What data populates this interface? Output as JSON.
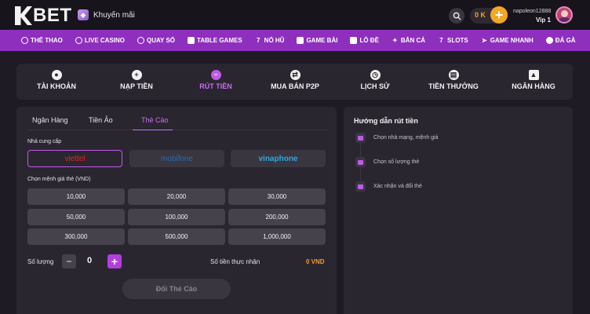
{
  "header": {
    "logo_text": "BET",
    "promo_label": "Khuyến mãi",
    "balance": "0 K",
    "deposit_symbol": "+",
    "username": "napoleon12888",
    "vip": "Vip 1"
  },
  "main_nav": [
    {
      "label": "THỂ THAO",
      "icon": "soccer-ball-icon"
    },
    {
      "label": "LIVE CASINO",
      "icon": "casino-chip-icon"
    },
    {
      "label": "QUAY SỐ",
      "icon": "lottery-ball-icon"
    },
    {
      "label": "TABLE GAMES",
      "icon": "cards-table-icon"
    },
    {
      "label": "NỔ HŨ",
      "icon": "slot-seven-icon"
    },
    {
      "label": "GAME BÀI",
      "icon": "playing-card-icon"
    },
    {
      "label": "LÔ ĐỀ",
      "icon": "lotto-icon"
    },
    {
      "label": "BẮN CÁ",
      "icon": "fish-icon"
    },
    {
      "label": "SLOTS",
      "icon": "slots-icon"
    },
    {
      "label": "GAME NHANH",
      "icon": "rocket-icon"
    },
    {
      "label": "ĐÁ GÀ",
      "icon": "rooster-icon"
    }
  ],
  "account_menu": [
    {
      "label": "TÀI KHOẢN",
      "icon": "user-icon"
    },
    {
      "label": "NẠP TIỀN",
      "icon": "plus-circle-icon"
    },
    {
      "label": "RÚT TIỀN",
      "icon": "minus-circle-icon",
      "active": true
    },
    {
      "label": "MUA BÁN P2P",
      "icon": "exchange-icon"
    },
    {
      "label": "LỊCH SỬ",
      "icon": "clock-icon"
    },
    {
      "label": "TIỀN THƯỞNG",
      "icon": "gift-icon"
    },
    {
      "label": "NGÂN HÀNG",
      "icon": "bank-icon"
    }
  ],
  "withdraw": {
    "tabs": [
      "Ngân Hàng",
      "Tiền Ảo",
      "Thẻ Cào"
    ],
    "active_tab": "Thẻ Cào",
    "provider_label": "Nhà cung cấp",
    "providers": [
      "viettel",
      "mobifone",
      "vinaphone"
    ],
    "selected_provider": "viettel",
    "denomination_label": "Chọn mệnh giá thẻ (VND)",
    "denominations": [
      "10,000",
      "20,000",
      "30,000",
      "50,000",
      "100,000",
      "200,000",
      "300,000",
      "500,000",
      "1,000,000"
    ],
    "quantity_label": "Số lượng",
    "quantity_minus": "−",
    "quantity_plus": "+",
    "quantity": "0",
    "receive_label": "Số tiền thực nhận",
    "receive_value": "0 VND",
    "submit_label": "Đổi Thẻ Cào"
  },
  "guide": {
    "title": "Hướng dẫn rút tiền",
    "steps": [
      "Chọn nhà mạng, mệnh giá",
      "Chọn số lượng thẻ",
      "Xác nhận và đổi thẻ"
    ]
  },
  "colors": {
    "accent": "#8e2fbe",
    "active_text": "#c96df0",
    "balance": "#f0a030"
  }
}
